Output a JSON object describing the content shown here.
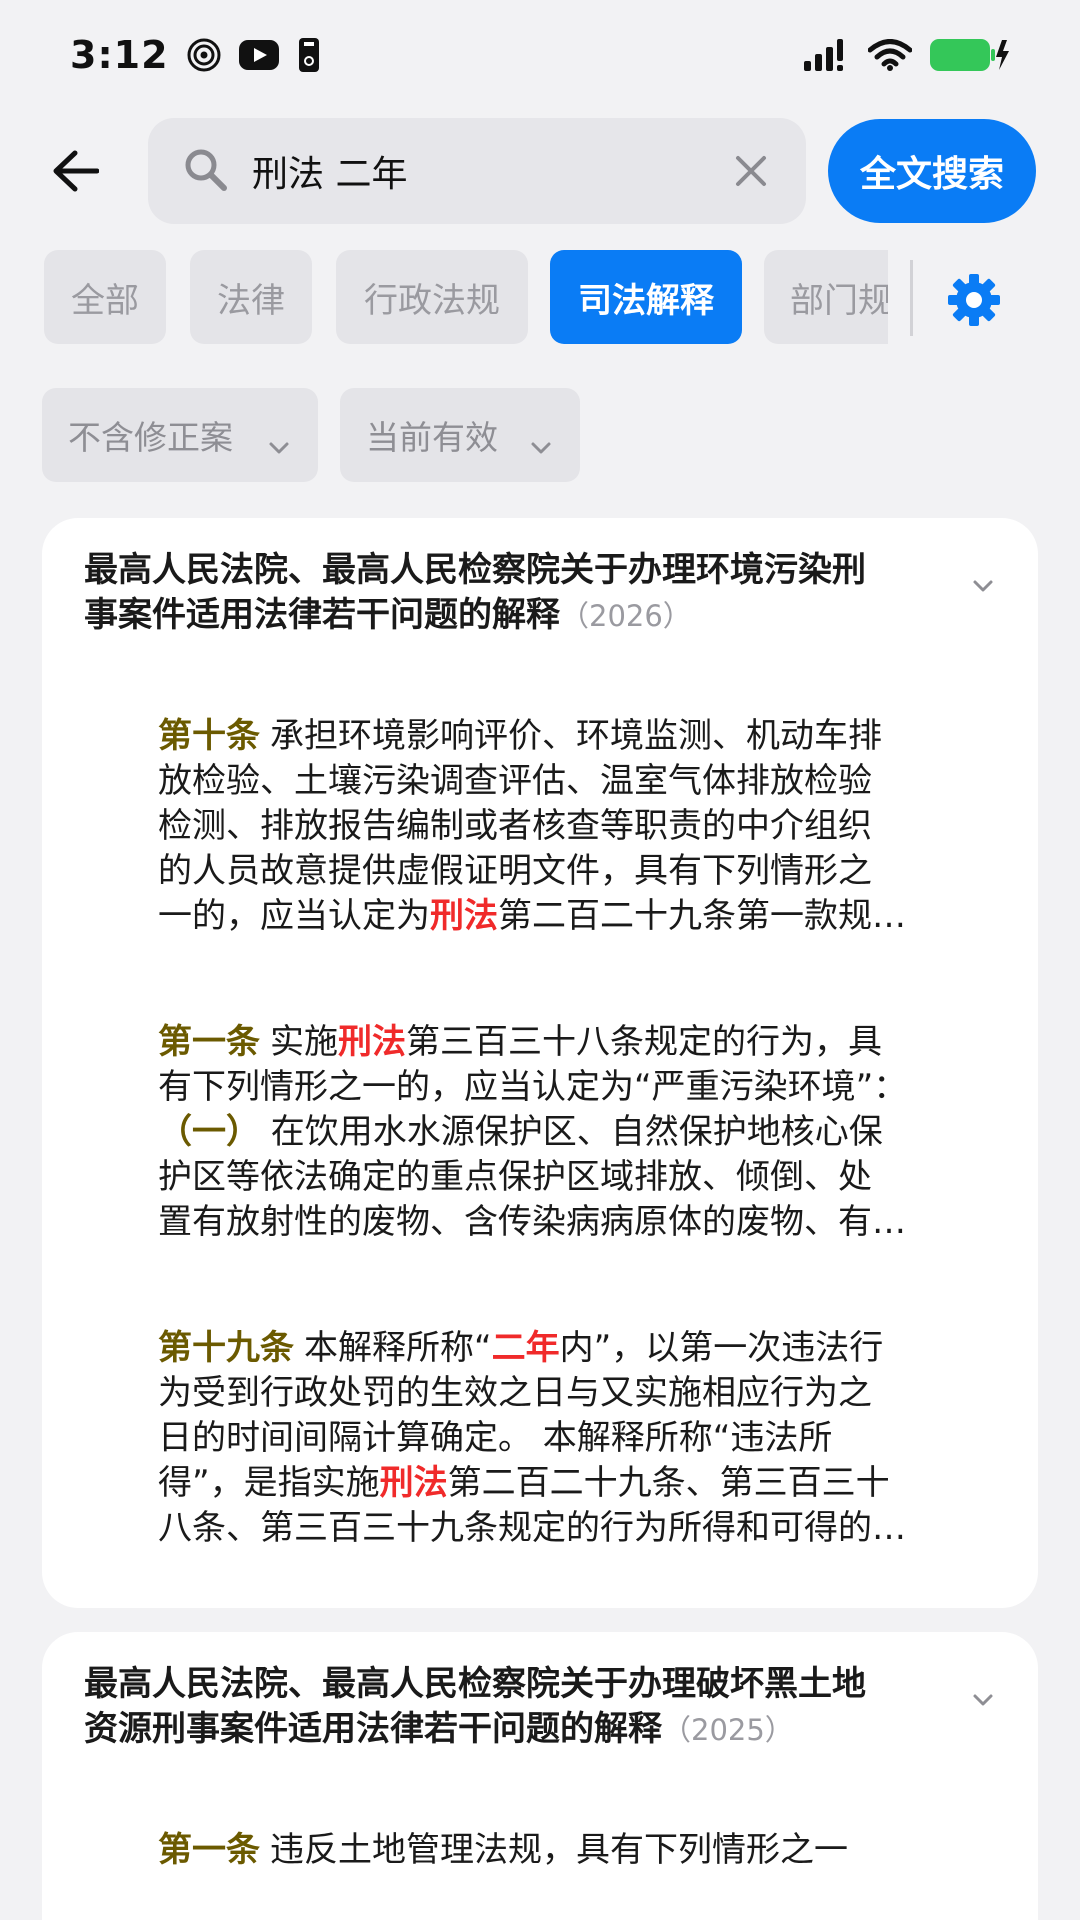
{
  "status_bar": {
    "time": "3:12",
    "left_icons": [
      "spiral-icon",
      "youtube-icon",
      "sim-icon"
    ],
    "right_icons": [
      "cellular-signal-icon",
      "wifi-icon",
      "battery-charging-icon"
    ],
    "battery_color": "#34c759"
  },
  "search": {
    "query": "刑法 二年",
    "fulltext_button": "全文搜索"
  },
  "tabs": [
    {
      "label": "全部",
      "active": false
    },
    {
      "label": "法律",
      "active": false
    },
    {
      "label": "行政法规",
      "active": false
    },
    {
      "label": "司法解释",
      "active": true
    },
    {
      "label": "部门规",
      "active": false
    }
  ],
  "filters": [
    {
      "label": "不含修正案"
    },
    {
      "label": "当前有效"
    }
  ],
  "colors": {
    "accent": "#0a7cf5",
    "highlight": "#f02a2a",
    "article_number": "#6b5a00"
  },
  "cards": [
    {
      "title_line1": "最高人民法院、最高人民检察院关于办理环境污染刑",
      "title_line2": "事案件适用法律若干问题的解释",
      "year": "（2026）",
      "articles": [
        {
          "number": "第十条",
          "lines": [
            [
              {
                "t": "承担环境影响评价、环境监测、机动车排"
              }
            ],
            [
              {
                "t": "放检验、土壤污染调查评估、温室气体排放检验"
              }
            ],
            [
              {
                "t": "检测、排放报告编制或者核查等职责的中介组织"
              }
            ],
            [
              {
                "t": "的人员故意提供虚假证明文件，具有下列情形之"
              }
            ],
            [
              {
                "t": "一的，应当认定为"
              },
              {
                "t": "刑法",
                "h": true
              },
              {
                "t": "第二百二十九条第一款规…"
              }
            ]
          ]
        },
        {
          "number": "第一条",
          "lines": [
            [
              {
                "t": "实施"
              },
              {
                "t": "刑法",
                "h": true
              },
              {
                "t": "第三百三十八条规定的行为，具"
              }
            ],
            [
              {
                "t": "有下列情形之一的，应当认定为“严重污染环境”："
              }
            ],
            [
              {
                "t": "（一）",
                "m": true
              },
              {
                "t": " 在饮用水水源保护区、自然保护地核心保"
              }
            ],
            [
              {
                "t": "护区等依法确定的重点保护区域排放、倾倒、处"
              }
            ],
            [
              {
                "t": "置有放射性的废物、含传染病病原体的废物、有…"
              }
            ]
          ]
        },
        {
          "number": "第十九条",
          "lines": [
            [
              {
                "t": "本解释所称“"
              },
              {
                "t": "二年",
                "h": true
              },
              {
                "t": "内”，以第一次违法行"
              }
            ],
            [
              {
                "t": "为受到行政处罚的生效之日与又实施相应行为之"
              }
            ],
            [
              {
                "t": "日的时间间隔计算确定。 本解释所称“违法所"
              }
            ],
            [
              {
                "t": "得”，是指实施"
              },
              {
                "t": "刑法",
                "h": true
              },
              {
                "t": "第二百二十九条、第三百三十"
              }
            ],
            [
              {
                "t": "八条、第三百三十九条规定的行为所得和可得的…"
              }
            ]
          ]
        }
      ]
    },
    {
      "title_line1": "最高人民法院、最高人民检察院关于办理破坏黑土地",
      "title_line2": "资源刑事案件适用法律若干问题的解释",
      "year": "（2025）",
      "articles": [
        {
          "number": "第一条",
          "lines": [
            [
              {
                "t": "违反土地管理法规，具有下列情形之一"
              }
            ]
          ]
        }
      ]
    }
  ]
}
